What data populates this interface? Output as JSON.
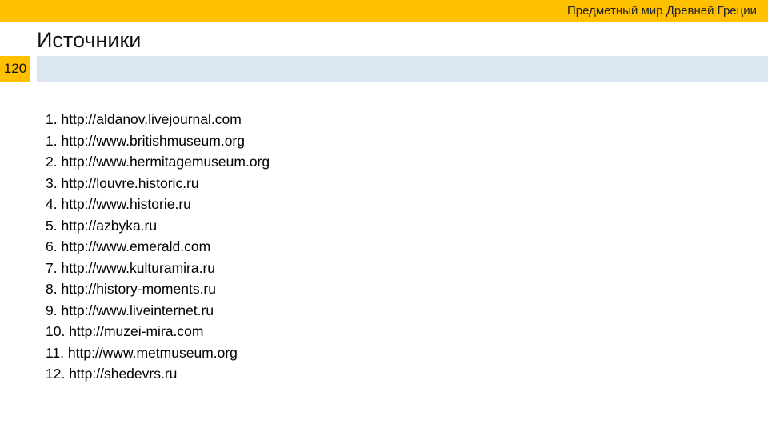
{
  "header": {
    "course_title": "Предметный мир Древней Греции"
  },
  "slide": {
    "title": "Источники",
    "number": "120"
  },
  "colors": {
    "accent": "#FFC000",
    "band": "#DCE6F2"
  },
  "sources": [
    "1. http://aldanov.livejournal.com",
    "1. http://www.britishmuseum.org",
    "2. http://www.hermitagemuseum.org",
    "3. http://louvre.historic.ru",
    "4. http://www.historie.ru",
    "5. http://azbyka.ru",
    "6. http://www.emerald.com",
    "7. http://www.kulturamira.ru",
    "8. http://history-moments.ru",
    "9. http://www.liveinternet.ru",
    "10. http://muzei-mira.com",
    "11. http://www.metmuseum.org",
    "12. http://shedevrs.ru"
  ]
}
